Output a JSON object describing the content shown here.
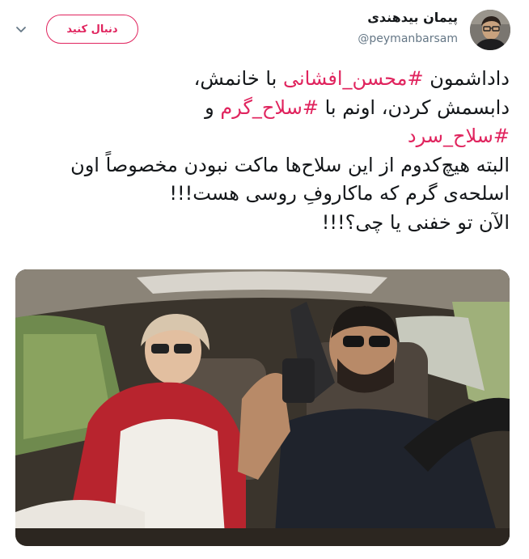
{
  "header": {
    "display_name": "پیمان بیدهندی",
    "handle": "@peymanbarsam",
    "follow_label": "دنبال کنید"
  },
  "tweet": {
    "line1_prefix": "داداشمون ",
    "hashtag1": "#محسن_افشانی",
    "line1_suffix": " با خانمش،",
    "line2_prefix": "دابسمش کردن، اونم با ",
    "hashtag2": "#سلاح_گرم",
    "line2_suffix": " و",
    "hashtag3": "#سلاح_سرد",
    "paragraph2": "البته هیچ‌کدوم از این سلاح‌ها ماکت نبودن مخصوصاً اون اسلحه‌ی گرم که ماکاروفِ روسی هست!!!",
    "paragraph3": "الآن تو خفنی یا چی؟!!!"
  },
  "icons": {
    "avatar": "profile-photo",
    "caret": "chevron-down-icon",
    "media": "car-video-thumbnail"
  },
  "colors": {
    "accent": "#e0245e",
    "text": "#14171a",
    "secondary": "#657786"
  }
}
